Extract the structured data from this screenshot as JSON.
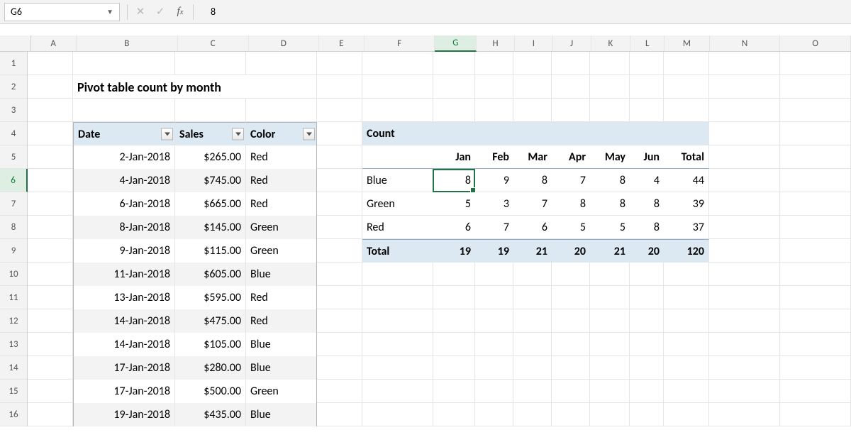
{
  "formula_bar": {
    "cell_ref": "G6",
    "value": "8"
  },
  "columns": [
    "A",
    "B",
    "C",
    "D",
    "E",
    "F",
    "G",
    "H",
    "I",
    "J",
    "K",
    "L",
    "M",
    "N",
    "O"
  ],
  "rows": [
    "1",
    "2",
    "3",
    "4",
    "5",
    "6",
    "7",
    "8",
    "9",
    "10",
    "11",
    "12",
    "13",
    "14",
    "15",
    "16"
  ],
  "title": "Pivot table count by month",
  "source_table": {
    "headers": {
      "date": "Date",
      "sales": "Sales",
      "color": "Color"
    },
    "rows": [
      {
        "date": "2-Jan-2018",
        "sales": "$265.00",
        "color": "Red"
      },
      {
        "date": "4-Jan-2018",
        "sales": "$745.00",
        "color": "Red"
      },
      {
        "date": "6-Jan-2018",
        "sales": "$665.00",
        "color": "Red"
      },
      {
        "date": "8-Jan-2018",
        "sales": "$145.00",
        "color": "Green"
      },
      {
        "date": "9-Jan-2018",
        "sales": "$115.00",
        "color": "Green"
      },
      {
        "date": "11-Jan-2018",
        "sales": "$605.00",
        "color": "Blue"
      },
      {
        "date": "13-Jan-2018",
        "sales": "$595.00",
        "color": "Red"
      },
      {
        "date": "14-Jan-2018",
        "sales": "$475.00",
        "color": "Red"
      },
      {
        "date": "14-Jan-2018",
        "sales": "$105.00",
        "color": "Blue"
      },
      {
        "date": "17-Jan-2018",
        "sales": "$280.00",
        "color": "Blue"
      },
      {
        "date": "17-Jan-2018",
        "sales": "$500.00",
        "color": "Green"
      },
      {
        "date": "19-Jan-2018",
        "sales": "$435.00",
        "color": "Blue"
      }
    ]
  },
  "pivot": {
    "title": "Count",
    "col_labels": [
      "Jan",
      "Feb",
      "Mar",
      "Apr",
      "May",
      "Jun",
      "Total"
    ],
    "rows": [
      {
        "label": "Blue",
        "values": [
          "8",
          "9",
          "8",
          "7",
          "8",
          "4",
          "44"
        ]
      },
      {
        "label": "Green",
        "values": [
          "5",
          "3",
          "7",
          "8",
          "8",
          "8",
          "39"
        ]
      },
      {
        "label": "Red",
        "values": [
          "6",
          "7",
          "6",
          "5",
          "5",
          "8",
          "37"
        ]
      }
    ],
    "total_label": "Total",
    "total_values": [
      "19",
      "19",
      "21",
      "20",
      "21",
      "20",
      "120"
    ]
  }
}
